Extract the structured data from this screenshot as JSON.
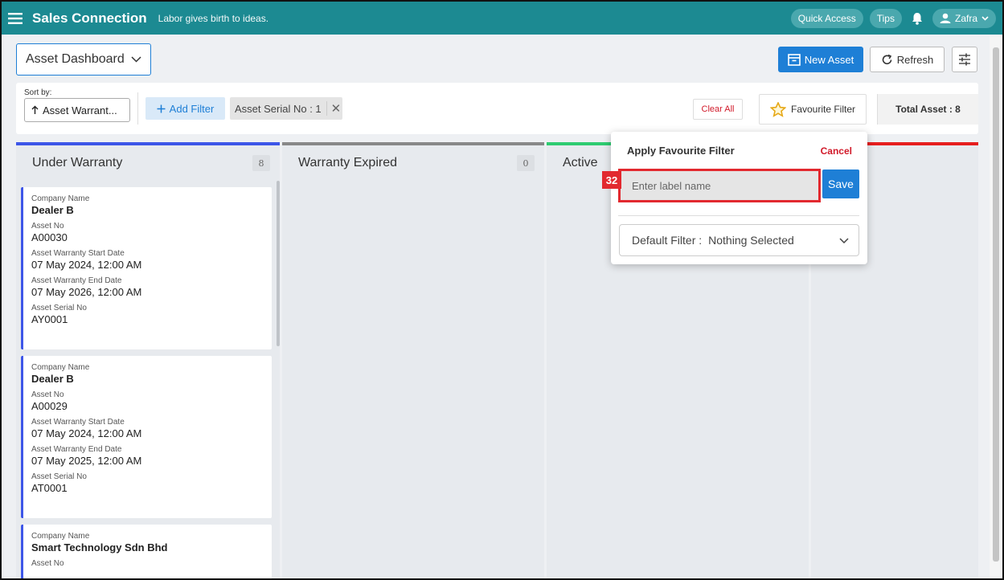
{
  "topbar": {
    "app_title": "Sales Connection",
    "tagline": "Labor gives birth to ideas.",
    "quick_access": "Quick Access",
    "tips": "Tips",
    "user_name": "Zafra"
  },
  "header": {
    "dashboard_select": "Asset Dashboard",
    "new_asset": "New Asset",
    "refresh": "Refresh"
  },
  "filter_bar": {
    "sort_label": "Sort by:",
    "sort_value": "Asset Warrant...",
    "add_filter": "Add Filter",
    "chip": "Asset Serial No : 1",
    "clear_all": "Clear All",
    "favourite_filter": "Favourite Filter",
    "total_asset": "Total Asset : 8"
  },
  "columns": [
    {
      "title": "Under Warranty",
      "count": "8",
      "color": "#3d56e8"
    },
    {
      "title": "Warranty Expired",
      "count": "0",
      "color": "#888888"
    },
    {
      "title": "Active",
      "count": "",
      "color": "#2ecc71"
    },
    {
      "title": "",
      "count": "",
      "color": "#e61e1e"
    }
  ],
  "cards": [
    {
      "company_label": "Company Name",
      "company": "Dealer B",
      "asset_no_label": "Asset No",
      "asset_no": "A00030",
      "start_label": "Asset Warranty Start Date",
      "start": "07 May 2024, 12:00 AM",
      "end_label": "Asset Warranty End Date",
      "end": "07 May 2026, 12:00 AM",
      "serial_label": "Asset Serial No",
      "serial": "AY0001"
    },
    {
      "company_label": "Company Name",
      "company": "Dealer B",
      "asset_no_label": "Asset No",
      "asset_no": "A00029",
      "start_label": "Asset Warranty Start Date",
      "start": "07 May 2024, 12:00 AM",
      "end_label": "Asset Warranty End Date",
      "end": "07 May 2025, 12:00 AM",
      "serial_label": "Asset Serial No",
      "serial": "AT0001"
    },
    {
      "company_label": "Company Name",
      "company": "Smart Technology Sdn Bhd",
      "asset_no_label": "Asset No"
    }
  ],
  "popup": {
    "title": "Apply Favourite Filter",
    "cancel": "Cancel",
    "label_placeholder": "Enter label name",
    "step_badge": "32",
    "save": "Save",
    "default_filter_label": "Default Filter :",
    "default_filter_value": "Nothing Selected"
  }
}
